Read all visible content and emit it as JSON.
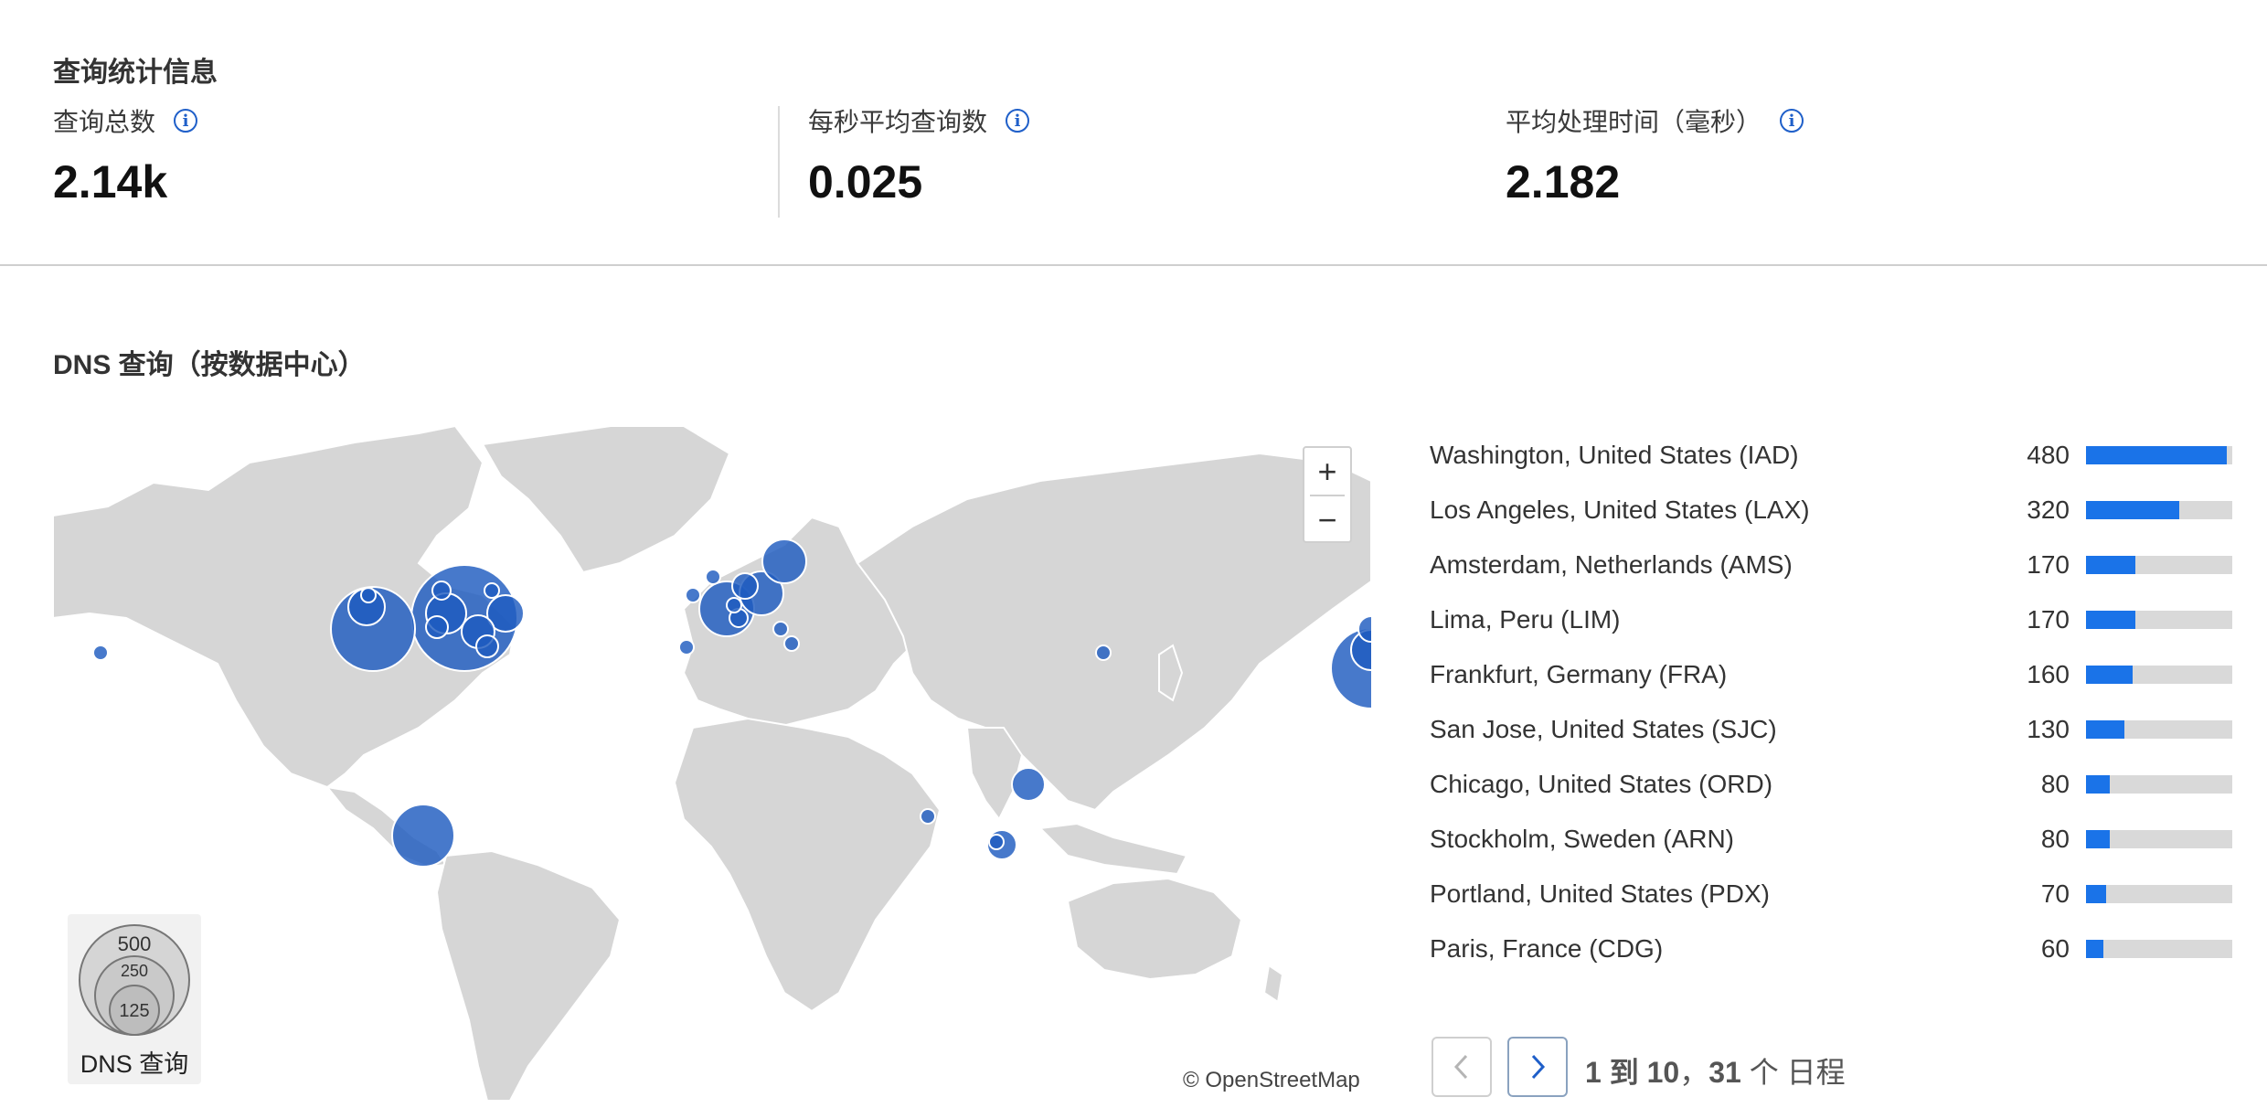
{
  "stats_section": {
    "title": "查询统计信息",
    "stats": [
      {
        "label": "查询总数",
        "value": "2.14k"
      },
      {
        "label": "每秒平均查询数",
        "value": "0.025"
      },
      {
        "label": "平均处理时间（毫秒）",
        "value": "2.182"
      }
    ],
    "info_glyph": "i"
  },
  "map_section": {
    "title": "DNS 查询（按数据中心）",
    "zoom_in": "+",
    "zoom_out": "−",
    "attribution": "© OpenStreetMap",
    "legend": {
      "title": "DNS 查询",
      "sizes": [
        "500",
        "250",
        "125"
      ]
    },
    "bubble_color": "#1f5bbf"
  },
  "datacenters": {
    "max_value": 500,
    "accent": "#1a73e8",
    "rows": [
      {
        "name": "Washington, United States (IAD)",
        "value": 480
      },
      {
        "name": "Los Angeles, United States (LAX)",
        "value": 320
      },
      {
        "name": "Amsterdam, Netherlands (AMS)",
        "value": 170
      },
      {
        "name": "Lima, Peru (LIM)",
        "value": 170
      },
      {
        "name": "Frankfurt, Germany (FRA)",
        "value": 160
      },
      {
        "name": "San Jose, United States (SJC)",
        "value": 130
      },
      {
        "name": "Chicago, United States (ORD)",
        "value": 80
      },
      {
        "name": "Stockholm, Sweden (ARN)",
        "value": 80
      },
      {
        "name": "Portland, United States (PDX)",
        "value": 70
      },
      {
        "name": "Paris, France (CDG)",
        "value": 60
      }
    ]
  },
  "pagination": {
    "range": "1 到 10",
    "separator": "，",
    "total": "31",
    "suffix": " 个 日程"
  }
}
